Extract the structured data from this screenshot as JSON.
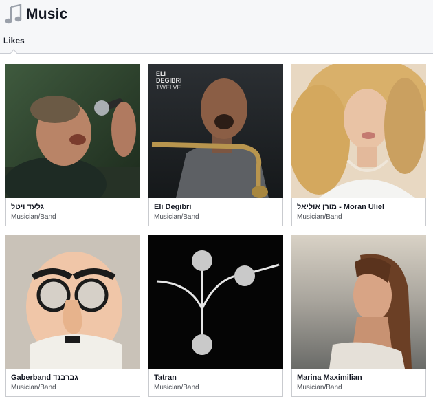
{
  "header": {
    "title": "Music",
    "icon": "music-note-icon"
  },
  "tabs": [
    {
      "label": "Likes",
      "active": true
    }
  ],
  "pages": [
    {
      "name": "גלעד ויטל",
      "category": "Musician/Band",
      "image": "singer-with-microphone-photo"
    },
    {
      "name": "Eli Degibri",
      "category": "Musician/Band",
      "image": "album-cover-saxophonist-photo",
      "cover_text": [
        "ELI",
        "DEGIBRI",
        "TWELVE"
      ]
    },
    {
      "name": "מורן אוליאל - Moran Uliel",
      "category": "Musician/Band",
      "image": "blonde-woman-portrait-photo"
    },
    {
      "name": "Gaberband גברבנד",
      "category": "Musician/Band",
      "image": "baby-with-disguise-glasses-photo"
    },
    {
      "name": "Tatran",
      "category": "Musician/Band",
      "image": "tree-symbol-logo"
    },
    {
      "name": "Marina Maximilian",
      "category": "Musician/Band",
      "image": "woman-portrait-photo"
    }
  ],
  "colors": {
    "header_bg": "#f6f7f9",
    "border": "#c9cbcf",
    "text": "#141823",
    "subtext": "#4b4f56"
  }
}
